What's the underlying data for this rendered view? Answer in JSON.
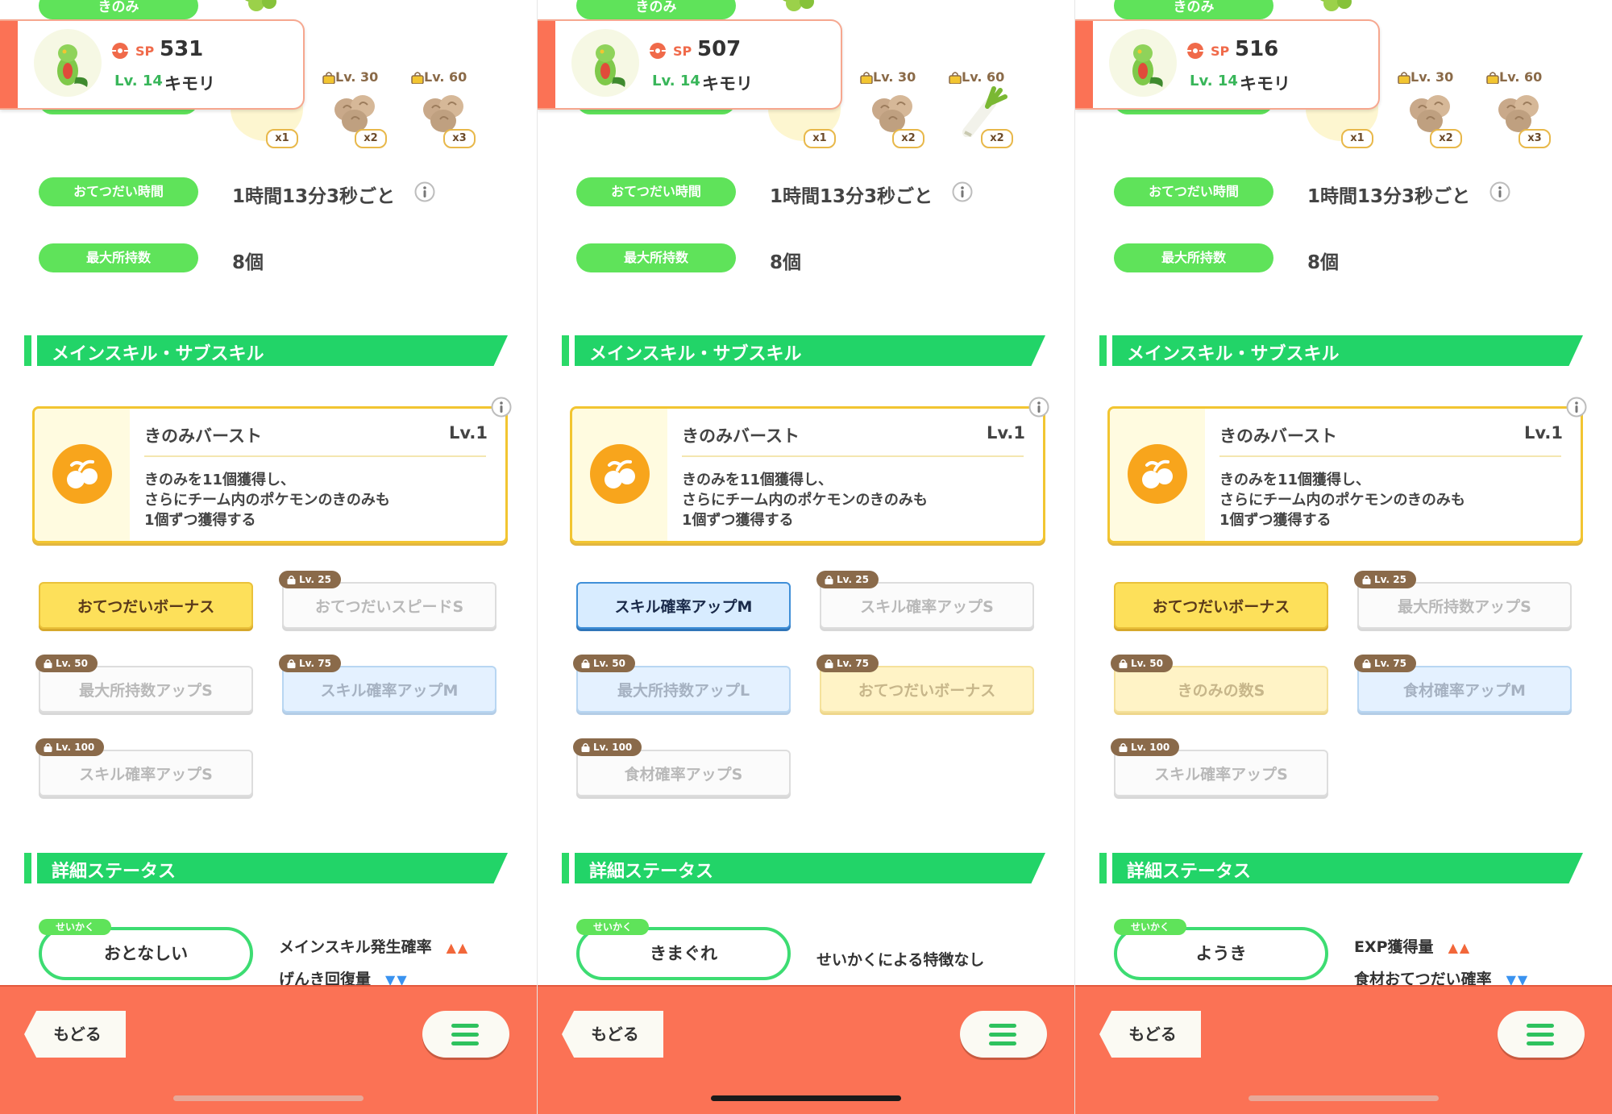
{
  "colors": {
    "green": "#5fe35a",
    "section_green": "#22d468",
    "footer": "#fb7255",
    "gold": "#f2c531"
  },
  "panels": [
    {
      "top_label": "きのみ",
      "sp_label": "SP",
      "sp": "531",
      "level": "Lv. 14",
      "name": "キモリ",
      "ingredients": [
        {
          "count": "x1"
        },
        {
          "lock": "Lv. 30",
          "icon": "walnut-icon",
          "count": "x2"
        },
        {
          "lock": "Lv. 60",
          "icon": "walnut-icon",
          "count": "x3"
        }
      ],
      "help_time_label": "おてつだい時間",
      "help_time": "1時間13分3秒ごと",
      "max_carry_label": "最大所持数",
      "max_carry": "8個",
      "skills_header": "メインスキル・サブスキル",
      "main_skill": {
        "name": "きのみバースト",
        "level": "Lv.1",
        "desc1": "きのみを11個獲得し、",
        "desc2": "さらにチーム内のポケモンのきのみも",
        "desc3": "1個ずつ獲得する"
      },
      "subskills": [
        {
          "label": "おてつだいボーナス",
          "style": "gold"
        },
        {
          "lock": "Lv. 25",
          "label": "おてつだいスピードS",
          "style": "white"
        },
        {
          "lock": "Lv. 50",
          "label": "最大所持数アップS",
          "style": "white"
        },
        {
          "lock": "Lv. 75",
          "label": "スキル確率アップM",
          "style": "blue"
        },
        {
          "lock": "Lv. 100",
          "label": "スキル確率アップS",
          "style": "white"
        }
      ],
      "detail_header": "詳細ステータス",
      "nature_tag": "せいかく",
      "nature": "おとなしい",
      "effects": [
        {
          "text": "メインスキル発生確率",
          "arrows": "▲▲",
          "dir": "up"
        },
        {
          "text": "げんき回復量",
          "arrows": "▼▼",
          "dir": "down"
        }
      ],
      "back_label": "もどる"
    },
    {
      "top_label": "きのみ",
      "sp_label": "SP",
      "sp": "507",
      "level": "Lv. 14",
      "name": "キモリ",
      "ingredients": [
        {
          "count": "x1"
        },
        {
          "lock": "Lv. 30",
          "icon": "walnut-icon",
          "count": "x2"
        },
        {
          "lock": "Lv. 60",
          "icon": "leek-icon",
          "count": "x2"
        }
      ],
      "help_time_label": "おてつだい時間",
      "help_time": "1時間13分3秒ごと",
      "max_carry_label": "最大所持数",
      "max_carry": "8個",
      "skills_header": "メインスキル・サブスキル",
      "main_skill": {
        "name": "きのみバースト",
        "level": "Lv.1",
        "desc1": "きのみを11個獲得し、",
        "desc2": "さらにチーム内のポケモンのきのみも",
        "desc3": "1個ずつ獲得する"
      },
      "subskills": [
        {
          "label": "スキル確率アップM",
          "style": "blue-act"
        },
        {
          "lock": "Lv. 25",
          "label": "スキル確率アップS",
          "style": "white"
        },
        {
          "lock": "Lv. 50",
          "label": "最大所持数アップL",
          "style": "blue"
        },
        {
          "lock": "Lv. 75",
          "label": "おてつだいボーナス",
          "style": "yellow"
        },
        {
          "lock": "Lv. 100",
          "label": "食材確率アップS",
          "style": "white"
        }
      ],
      "detail_header": "詳細ステータス",
      "nature_tag": "せいかく",
      "nature": "きまぐれ",
      "effects": [
        {
          "text": "せいかくによる特徴なし",
          "arrows": "",
          "dir": "none"
        }
      ],
      "back_label": "もどる"
    },
    {
      "top_label": "きのみ",
      "sp_label": "SP",
      "sp": "516",
      "level": "Lv. 14",
      "name": "キモリ",
      "ingredients": [
        {
          "count": "x1"
        },
        {
          "lock": "Lv. 30",
          "icon": "walnut-icon",
          "count": "x2"
        },
        {
          "lock": "Lv. 60",
          "icon": "walnut-icon",
          "count": "x3"
        }
      ],
      "help_time_label": "おてつだい時間",
      "help_time": "1時間13分3秒ごと",
      "max_carry_label": "最大所持数",
      "max_carry": "8個",
      "skills_header": "メインスキル・サブスキル",
      "main_skill": {
        "name": "きのみバースト",
        "level": "Lv.1",
        "desc1": "きのみを11個獲得し、",
        "desc2": "さらにチーム内のポケモンのきのみも",
        "desc3": "1個ずつ獲得する"
      },
      "subskills": [
        {
          "label": "おてつだいボーナス",
          "style": "gold"
        },
        {
          "lock": "Lv. 25",
          "label": "最大所持数アップS",
          "style": "white"
        },
        {
          "lock": "Lv. 50",
          "label": "きのみの数S",
          "style": "yellow"
        },
        {
          "lock": "Lv. 75",
          "label": "食材確率アップM",
          "style": "blue"
        },
        {
          "lock": "Lv. 100",
          "label": "スキル確率アップS",
          "style": "white"
        }
      ],
      "detail_header": "詳細ステータス",
      "nature_tag": "せいかく",
      "nature": "ようき",
      "effects": [
        {
          "text": "EXP獲得量",
          "arrows": "▲▲",
          "dir": "up"
        },
        {
          "text": "食材おてつだい確率",
          "arrows": "▼▼",
          "dir": "down"
        }
      ],
      "back_label": "もどる"
    }
  ]
}
